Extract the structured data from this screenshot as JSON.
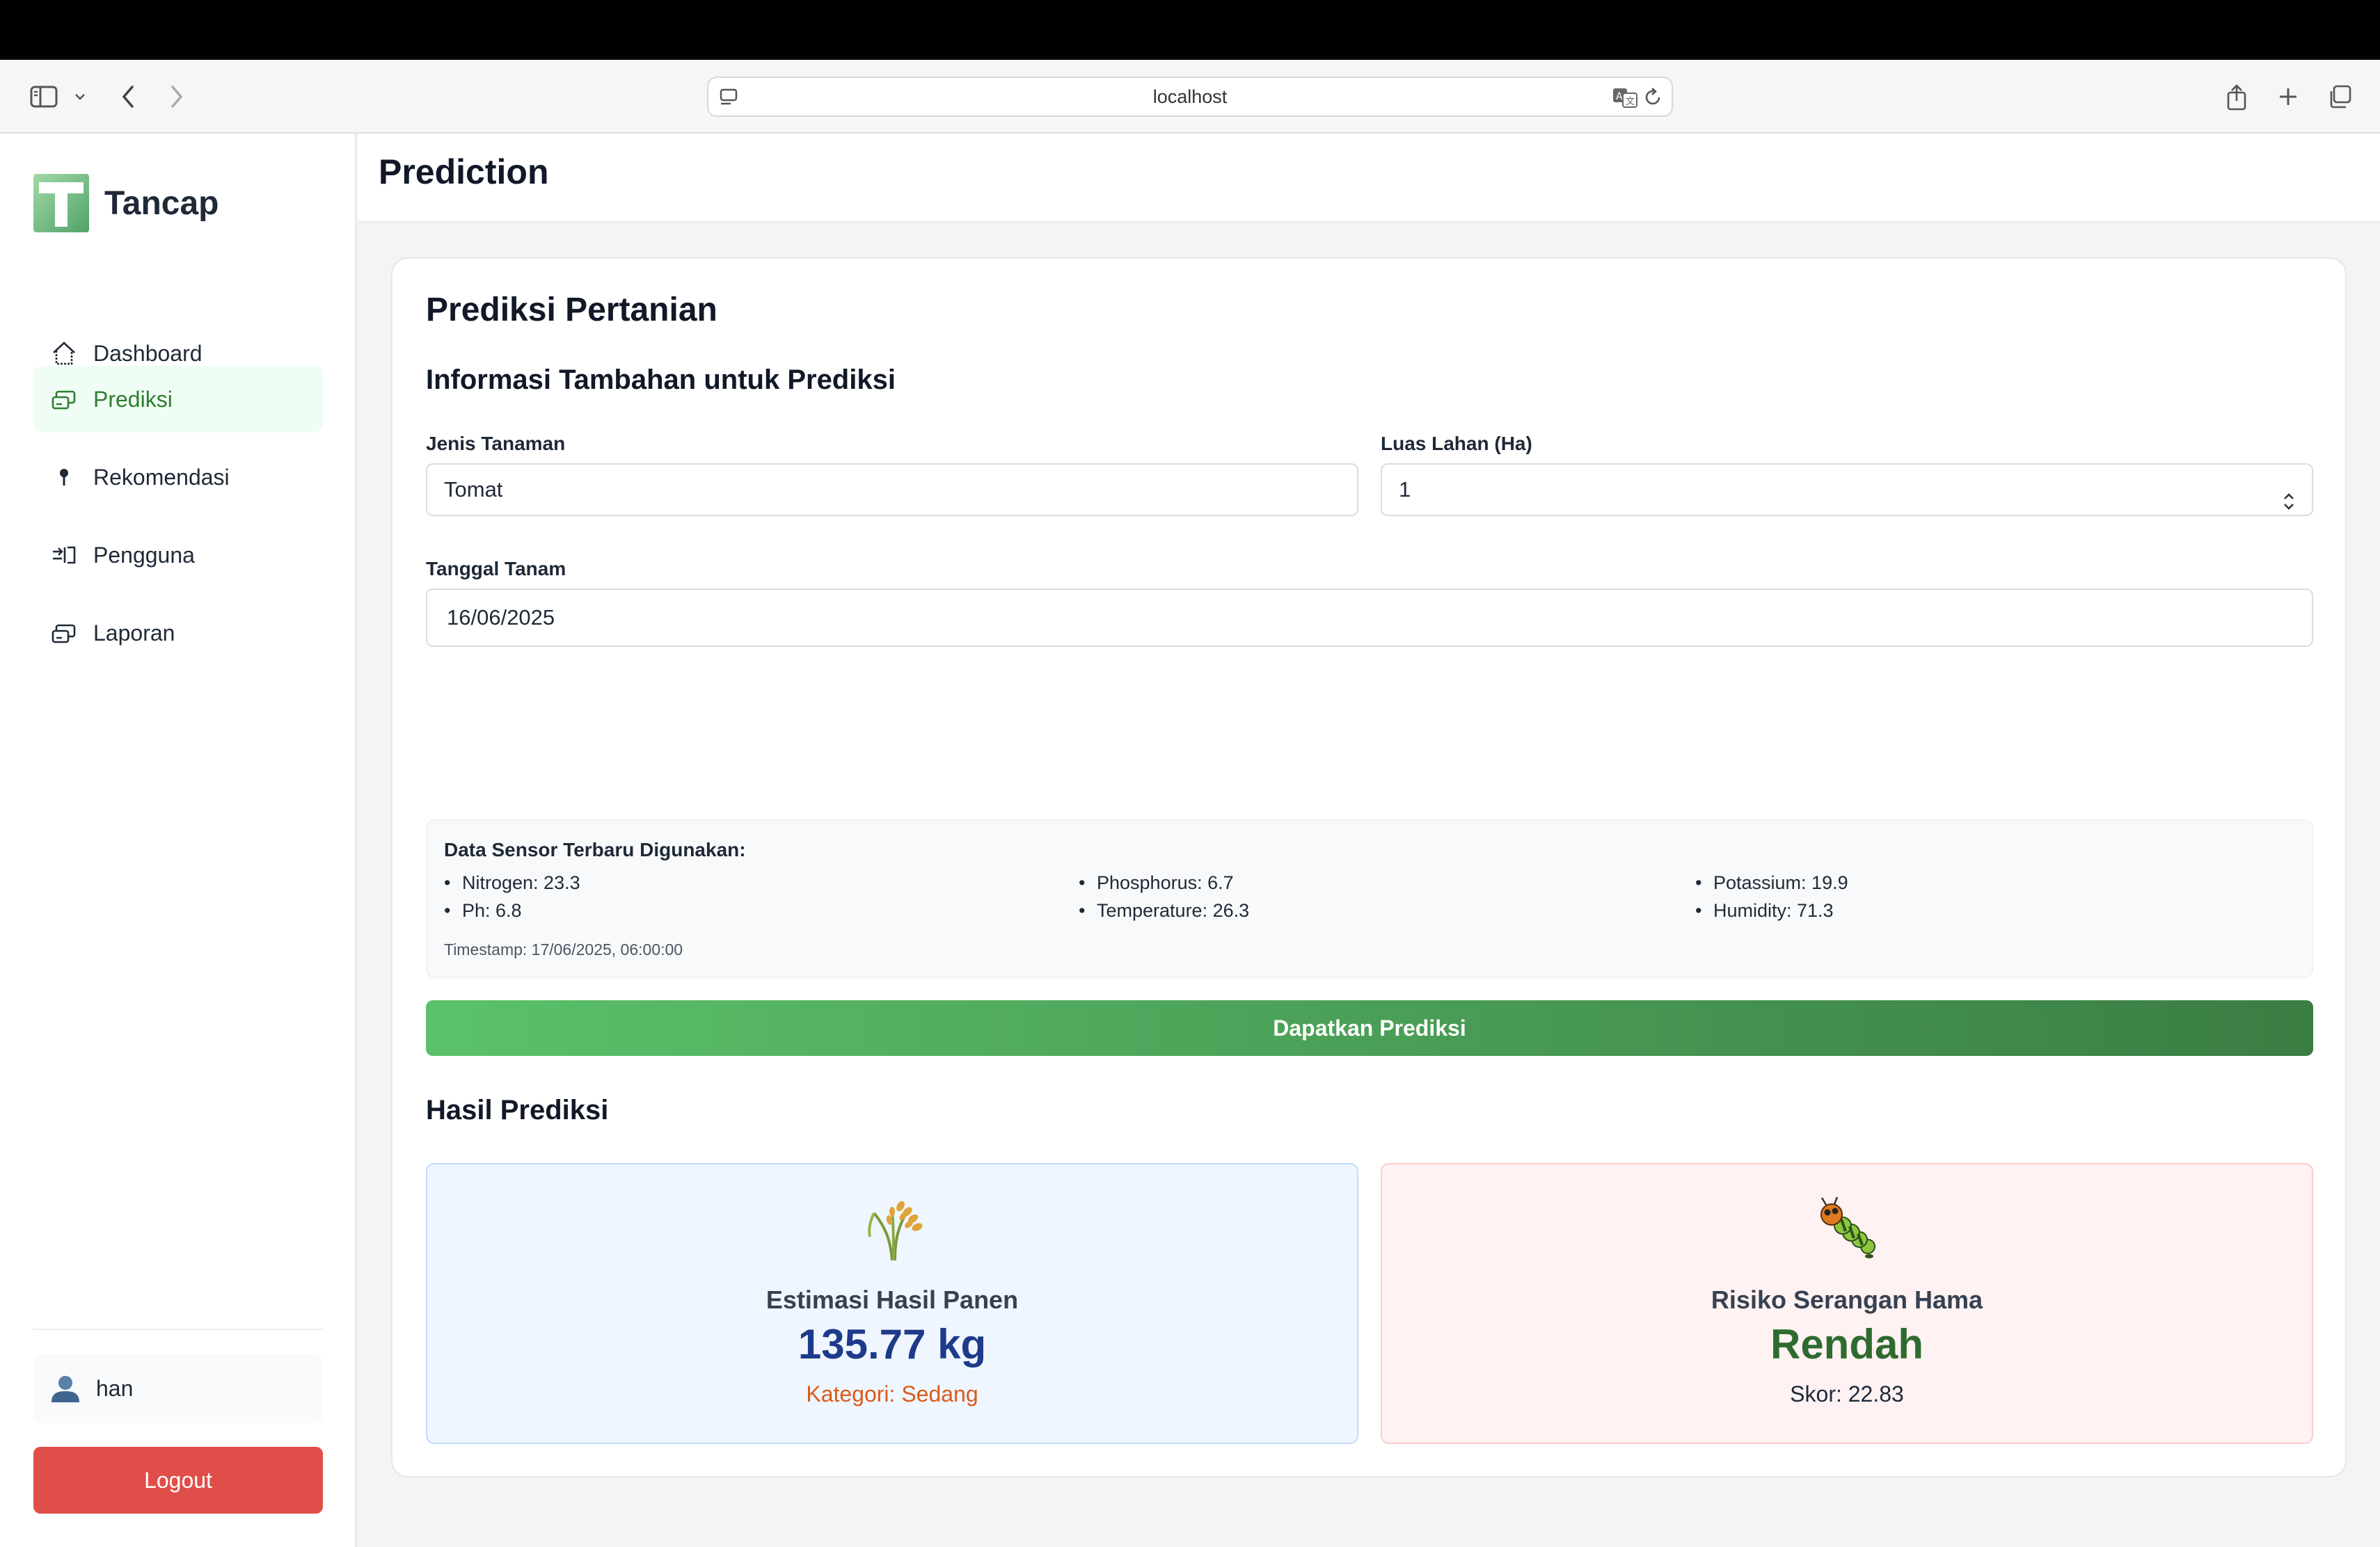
{
  "browser": {
    "url": "localhost"
  },
  "brand": {
    "name": "Tancap"
  },
  "sidebar": {
    "items": [
      {
        "label": "Dashboard",
        "icon": "home-icon",
        "active": false
      },
      {
        "label": "Prediksi",
        "icon": "prediction-icon",
        "active": true
      },
      {
        "label": "Rekomendasi",
        "icon": "pin-icon",
        "active": false
      },
      {
        "label": "Pengguna",
        "icon": "users-icon",
        "active": false
      },
      {
        "label": "Laporan",
        "icon": "report-icon",
        "active": false
      }
    ],
    "user": {
      "name": "han",
      "icon": "user-avatar-icon"
    },
    "logout_label": "Logout"
  },
  "header": {
    "title": "Prediction"
  },
  "card": {
    "title": "Prediksi Pertanian",
    "section_title": "Informasi Tambahan untuk Prediksi",
    "fields": {
      "crop": {
        "label": "Jenis Tanaman",
        "value": "Tomat"
      },
      "area": {
        "label": "Luas Lahan (Ha)",
        "value": "1"
      },
      "date": {
        "label": "Tanggal Tanam",
        "value": "16/06/2025"
      }
    },
    "sensor": {
      "title": "Data Sensor Terbaru Digunakan:",
      "items": [
        "Nitrogen: 23.3",
        "Phosphorus: 6.7",
        "Potassium: 19.9",
        "Ph: 6.8",
        "Temperature: 26.3",
        "Humidity: 71.3"
      ],
      "timestamp": "Timestamp: 17/06/2025, 06:00:00"
    },
    "predict_button_label": "Dapatkan Prediksi",
    "result": {
      "title": "Hasil Prediksi",
      "harvest": {
        "icon": "rice-sheaf-icon",
        "label": "Estimasi Hasil Panen",
        "value": "135.77 kg",
        "category": "Kategori: Sedang"
      },
      "pest": {
        "icon": "caterpillar-icon",
        "label": "Risiko Serangan Hama",
        "value": "Rendah",
        "score": "Skor: 22.83"
      }
    }
  },
  "colors": {
    "accent": "#2e7d32",
    "logout": "#e04e4a",
    "harvest_value": "#1e3a8a",
    "harvest_category": "#dd5a1a",
    "pest_value": "#2e6b2f"
  }
}
